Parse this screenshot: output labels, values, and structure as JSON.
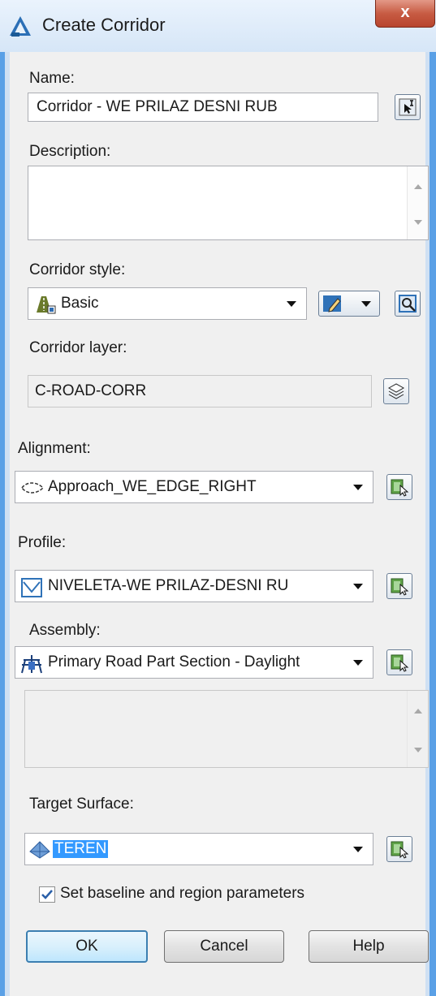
{
  "window": {
    "title": "Create Corridor",
    "close_glyph": "x"
  },
  "name": {
    "label": "Name:",
    "value": "Corridor - WE PRILAZ DESNI RUB"
  },
  "description": {
    "label": "Description:",
    "value": ""
  },
  "corridor_style": {
    "label": "Corridor style:",
    "value": "Basic"
  },
  "corridor_layer": {
    "label": "Corridor layer:",
    "value": "C-ROAD-CORR"
  },
  "alignment": {
    "label": "Alignment:",
    "value": "Approach_WE_EDGE_RIGHT"
  },
  "profile": {
    "label": "Profile:",
    "value": "NIVELETA-WE PRILAZ-DESNI RU"
  },
  "assembly": {
    "label": "Assembly:",
    "value": "Primary Road Part Section - Daylight"
  },
  "target_surface": {
    "label": "Target Surface:",
    "value": "TEREN"
  },
  "baseline_checkbox": {
    "label": "Set baseline and region parameters",
    "checked": true
  },
  "buttons": {
    "ok": "OK",
    "cancel": "Cancel",
    "help": "Help"
  },
  "colors": {
    "title_frame": "#5aa0e6",
    "close_button": "#c75b43",
    "selection": "#3399ff"
  },
  "icons": [
    "autocad-civil-icon",
    "pick-from-drawing-icon",
    "corridor-style-icon",
    "edit-style-icon",
    "preview-style-icon",
    "layer-icon",
    "alignment-icon",
    "select-in-drawing-icon",
    "profile-icon",
    "assembly-icon",
    "surface-icon"
  ]
}
